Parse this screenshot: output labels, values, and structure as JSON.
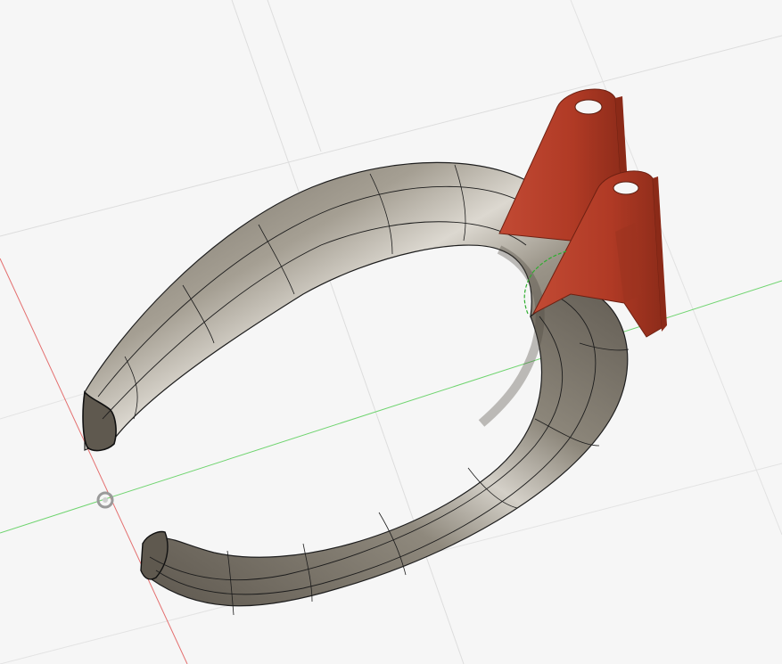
{
  "viewport": {
    "background": "#f6f6f6",
    "grid_color": "#dcdcdc",
    "x_axis_color": "#e26060",
    "y_axis_color": "#5ccf5c",
    "origin_icon": "origin-circle-icon"
  },
  "model": {
    "body_color": "#8c857a",
    "body_highlight": "#d8d4cc",
    "edge_color": "#1a1a1a",
    "bracket_color": "#b23a26",
    "bracket_dark": "#8a2a1a"
  }
}
